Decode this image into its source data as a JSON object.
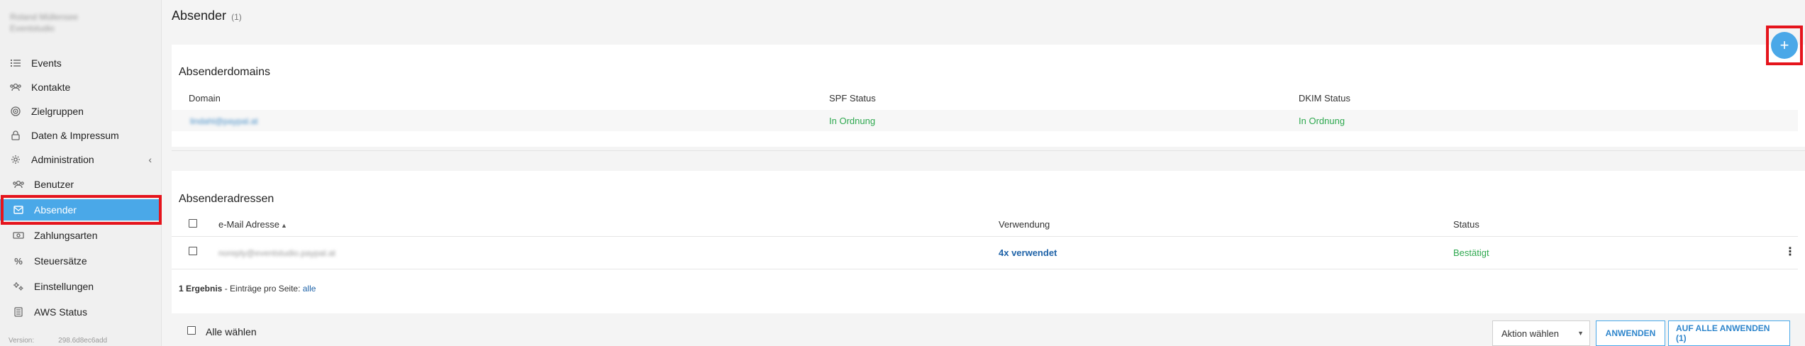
{
  "sidebar": {
    "org_line1": "Roland Müllensee",
    "org_line2": "Eventstudio",
    "items": [
      {
        "label": "Events",
        "icon": "list-icon"
      },
      {
        "label": "Kontakte",
        "icon": "contacts-icon"
      },
      {
        "label": "Zielgruppen",
        "icon": "target-icon"
      },
      {
        "label": "Daten & Impressum",
        "icon": "lock-icon"
      },
      {
        "label": "Administration",
        "icon": "gear-icon"
      }
    ],
    "subitems": [
      {
        "label": "Benutzer",
        "icon": "users-icon"
      },
      {
        "label": "Absender",
        "icon": "envelope-icon"
      },
      {
        "label": "Zahlungsarten",
        "icon": "money-icon"
      },
      {
        "label": "Steuersätze",
        "icon": "percent-icon"
      },
      {
        "label": "Einstellungen",
        "icon": "settings-icon"
      },
      {
        "label": "AWS Status",
        "icon": "server-icon"
      }
    ],
    "version_label": "Version:",
    "version_value": "298.6d8ec6add"
  },
  "page": {
    "title": "Absender",
    "count": "(1)"
  },
  "domains": {
    "title": "Absenderdomains",
    "headers": [
      "Domain",
      "SPF Status",
      "DKIM Status"
    ],
    "rows": [
      {
        "domain": "lindahl@paypal.at",
        "spf": "In Ordnung",
        "dkim": "In Ordnung"
      }
    ]
  },
  "addresses": {
    "title": "Absenderadressen",
    "headers": [
      "e-Mail Adresse",
      "Verwendung",
      "Status"
    ],
    "sort_indicator": "▲",
    "rows": [
      {
        "email": "noreply@eventstudio.paypal.at",
        "usage": "4x verwendet",
        "status": "Bestätigt"
      }
    ],
    "result_count": "1 Ergebnis",
    "result_text": " - Einträge pro Seite: ",
    "per_page": "alle"
  },
  "bottom": {
    "select_all": "Alle wählen",
    "action_select": "Aktion wählen",
    "apply": "ANWENDEN",
    "apply_all": "AUF ALLE ANWENDEN (1)"
  },
  "add_button": "+",
  "colors": {
    "accent": "#4aa8e8",
    "ok": "#2ea84f",
    "link": "#1f63a8",
    "highlight": "#e5141c"
  }
}
